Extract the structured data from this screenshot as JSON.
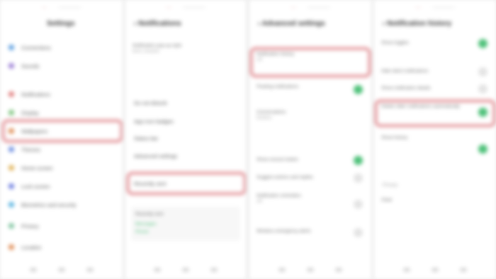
{
  "colors": {
    "accent_green": "#4fc17a",
    "highlight": "#e8a9ad",
    "background": "#eeeeee"
  },
  "screens": [
    {
      "statusbar": {
        "tab_a": "···",
        "tab_b": "············"
      },
      "title": "Settings",
      "items": [
        {
          "label": "Connections",
          "icon": "wifi-icon",
          "color": "#5fa0e0"
        },
        {
          "label": "Sounds",
          "icon": "sound-icon",
          "color": "#9b7fd6"
        },
        {
          "label": "Notifications",
          "icon": "notifications-icon",
          "color": "#e07f7f"
        },
        {
          "label": "Display",
          "icon": "display-icon",
          "color": "#7fc47f"
        },
        {
          "label": "Wallpapers",
          "icon": "wallpaper-icon",
          "color": "#e08f5a"
        },
        {
          "label": "Themes",
          "icon": "themes-icon",
          "color": "#6f8fe0"
        },
        {
          "label": "Home screen",
          "icon": "home-screen-icon",
          "color": "#e0b35a"
        },
        {
          "label": "Lock screen",
          "icon": "lock-screen-icon",
          "color": "#6f7fe0"
        },
        {
          "label": "Biometrics and security",
          "icon": "security-icon",
          "color": "#5ab3e0"
        },
        {
          "label": "Privacy",
          "icon": "privacy-icon",
          "color": "#7fc4a0"
        },
        {
          "label": "Location",
          "icon": "location-icon",
          "color": "#e08f5a"
        }
      ]
    },
    {
      "statusbar": {
        "tab_a": "···",
        "tab_b": "············"
      },
      "title": "Notifications",
      "intro": {
        "title": "Notification pop-up style",
        "desc": "Brief, Detailed"
      },
      "items": [
        "Do not disturb",
        "App icon badges",
        "Status bar",
        "Advanced settings",
        "Recently sent"
      ],
      "highlighted_item": "Advanced settings",
      "recent": {
        "header": "Recently sent",
        "entries": [
          "Messages",
          "Phone"
        ]
      }
    },
    {
      "statusbar": {
        "tab_a": "···",
        "tab_b": "············"
      },
      "title": "Advanced settings",
      "items": [
        {
          "label": "Notification history",
          "desc": "Off"
        },
        {
          "label": "Floating notifications",
          "desc": ""
        },
        {
          "label": "Conversations",
          "desc": "Bubbles"
        },
        {
          "label": "Show snooze button",
          "desc": ""
        },
        {
          "label": "Suggest actions and replies",
          "desc": ""
        },
        {
          "label": "Notification reminders",
          "desc": "Off"
        },
        {
          "label": "Wireless emergency alerts",
          "desc": ""
        }
      ]
    },
    {
      "statusbar": {
        "tab_a": "···",
        "tab_b": "············"
      },
      "title": "Notification history",
      "items": [
        {
          "label": "Show toggles",
          "toggle": true
        },
        {
          "label": "Hide silent notifications",
          "toggle": false
        },
        {
          "label": "Show notification details",
          "toggle": false
        },
        {
          "label": "Delete older notifications automatically",
          "toggle": true
        },
        {
          "label": "Show history",
          "desc": "",
          "toggle": true
        },
        {
          "label": "Clear",
          "toggle": null
        }
      ],
      "section": "Privacy"
    }
  ]
}
